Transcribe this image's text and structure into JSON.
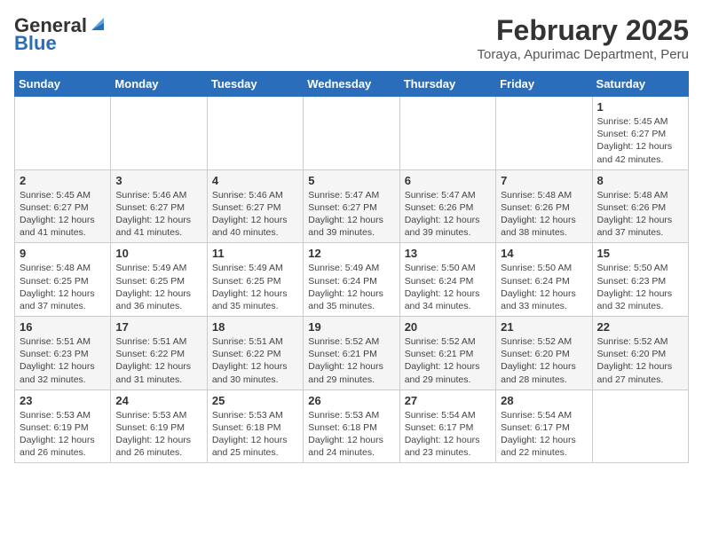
{
  "header": {
    "logo_general": "General",
    "logo_blue": "Blue",
    "month_title": "February 2025",
    "location": "Toraya, Apurimac Department, Peru"
  },
  "days_of_week": [
    "Sunday",
    "Monday",
    "Tuesday",
    "Wednesday",
    "Thursday",
    "Friday",
    "Saturday"
  ],
  "weeks": [
    [
      {
        "day": "",
        "info": ""
      },
      {
        "day": "",
        "info": ""
      },
      {
        "day": "",
        "info": ""
      },
      {
        "day": "",
        "info": ""
      },
      {
        "day": "",
        "info": ""
      },
      {
        "day": "",
        "info": ""
      },
      {
        "day": "1",
        "info": "Sunrise: 5:45 AM\nSunset: 6:27 PM\nDaylight: 12 hours\nand 42 minutes."
      }
    ],
    [
      {
        "day": "2",
        "info": "Sunrise: 5:45 AM\nSunset: 6:27 PM\nDaylight: 12 hours\nand 41 minutes."
      },
      {
        "day": "3",
        "info": "Sunrise: 5:46 AM\nSunset: 6:27 PM\nDaylight: 12 hours\nand 41 minutes."
      },
      {
        "day": "4",
        "info": "Sunrise: 5:46 AM\nSunset: 6:27 PM\nDaylight: 12 hours\nand 40 minutes."
      },
      {
        "day": "5",
        "info": "Sunrise: 5:47 AM\nSunset: 6:27 PM\nDaylight: 12 hours\nand 39 minutes."
      },
      {
        "day": "6",
        "info": "Sunrise: 5:47 AM\nSunset: 6:26 PM\nDaylight: 12 hours\nand 39 minutes."
      },
      {
        "day": "7",
        "info": "Sunrise: 5:48 AM\nSunset: 6:26 PM\nDaylight: 12 hours\nand 38 minutes."
      },
      {
        "day": "8",
        "info": "Sunrise: 5:48 AM\nSunset: 6:26 PM\nDaylight: 12 hours\nand 37 minutes."
      }
    ],
    [
      {
        "day": "9",
        "info": "Sunrise: 5:48 AM\nSunset: 6:25 PM\nDaylight: 12 hours\nand 37 minutes."
      },
      {
        "day": "10",
        "info": "Sunrise: 5:49 AM\nSunset: 6:25 PM\nDaylight: 12 hours\nand 36 minutes."
      },
      {
        "day": "11",
        "info": "Sunrise: 5:49 AM\nSunset: 6:25 PM\nDaylight: 12 hours\nand 35 minutes."
      },
      {
        "day": "12",
        "info": "Sunrise: 5:49 AM\nSunset: 6:24 PM\nDaylight: 12 hours\nand 35 minutes."
      },
      {
        "day": "13",
        "info": "Sunrise: 5:50 AM\nSunset: 6:24 PM\nDaylight: 12 hours\nand 34 minutes."
      },
      {
        "day": "14",
        "info": "Sunrise: 5:50 AM\nSunset: 6:24 PM\nDaylight: 12 hours\nand 33 minutes."
      },
      {
        "day": "15",
        "info": "Sunrise: 5:50 AM\nSunset: 6:23 PM\nDaylight: 12 hours\nand 32 minutes."
      }
    ],
    [
      {
        "day": "16",
        "info": "Sunrise: 5:51 AM\nSunset: 6:23 PM\nDaylight: 12 hours\nand 32 minutes."
      },
      {
        "day": "17",
        "info": "Sunrise: 5:51 AM\nSunset: 6:22 PM\nDaylight: 12 hours\nand 31 minutes."
      },
      {
        "day": "18",
        "info": "Sunrise: 5:51 AM\nSunset: 6:22 PM\nDaylight: 12 hours\nand 30 minutes."
      },
      {
        "day": "19",
        "info": "Sunrise: 5:52 AM\nSunset: 6:21 PM\nDaylight: 12 hours\nand 29 minutes."
      },
      {
        "day": "20",
        "info": "Sunrise: 5:52 AM\nSunset: 6:21 PM\nDaylight: 12 hours\nand 29 minutes."
      },
      {
        "day": "21",
        "info": "Sunrise: 5:52 AM\nSunset: 6:20 PM\nDaylight: 12 hours\nand 28 minutes."
      },
      {
        "day": "22",
        "info": "Sunrise: 5:52 AM\nSunset: 6:20 PM\nDaylight: 12 hours\nand 27 minutes."
      }
    ],
    [
      {
        "day": "23",
        "info": "Sunrise: 5:53 AM\nSunset: 6:19 PM\nDaylight: 12 hours\nand 26 minutes."
      },
      {
        "day": "24",
        "info": "Sunrise: 5:53 AM\nSunset: 6:19 PM\nDaylight: 12 hours\nand 26 minutes."
      },
      {
        "day": "25",
        "info": "Sunrise: 5:53 AM\nSunset: 6:18 PM\nDaylight: 12 hours\nand 25 minutes."
      },
      {
        "day": "26",
        "info": "Sunrise: 5:53 AM\nSunset: 6:18 PM\nDaylight: 12 hours\nand 24 minutes."
      },
      {
        "day": "27",
        "info": "Sunrise: 5:54 AM\nSunset: 6:17 PM\nDaylight: 12 hours\nand 23 minutes."
      },
      {
        "day": "28",
        "info": "Sunrise: 5:54 AM\nSunset: 6:17 PM\nDaylight: 12 hours\nand 22 minutes."
      },
      {
        "day": "",
        "info": ""
      }
    ]
  ]
}
